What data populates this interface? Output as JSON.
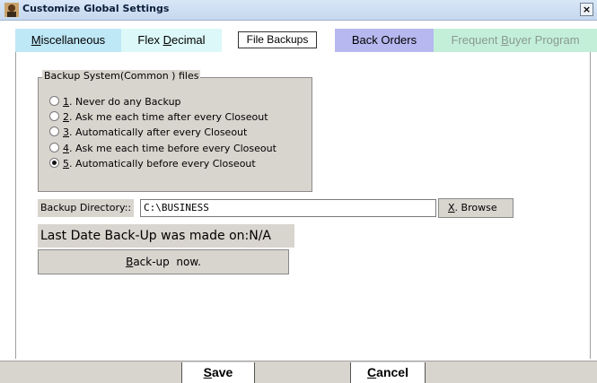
{
  "window": {
    "title": "Customize Global Settings",
    "close_label": "×",
    "icon": "app-icon"
  },
  "tabs": [
    {
      "key": "M",
      "rest": "iscellaneous",
      "prefix": "",
      "color": "#bfe8f7"
    },
    {
      "prefix": "Flex ",
      "key": "D",
      "rest": "ecimal",
      "color": "#dcf8f8"
    },
    {
      "label": "File Backups",
      "selected": true,
      "color": "#ffffff"
    },
    {
      "label": "Back Orders",
      "color": "#b6b8ef"
    },
    {
      "prefix": "Frequent ",
      "key": "B",
      "rest": "uyer Program",
      "color": "#c3efd9",
      "disabled": true
    }
  ],
  "backup_group": {
    "legend": "Backup System(Common ) files",
    "options": [
      {
        "num": "1",
        "text": ". Never do any Backup",
        "checked": false
      },
      {
        "num": "2",
        "text": ". Ask me each time after every Closeout",
        "checked": false
      },
      {
        "num": "3",
        "text": ". Automatically after every Closeout",
        "checked": false
      },
      {
        "num": "4",
        "text": ". Ask me each time before every Closeout",
        "checked": false
      },
      {
        "num": "5",
        "text": ". Automatically before every Closeout",
        "checked": true
      }
    ]
  },
  "directory": {
    "label": "Backup Directory::",
    "value": "C:\\BUSINESS",
    "browse_key": "X",
    "browse_rest": ". Browse"
  },
  "last_backup": {
    "text": "Last Date Back-Up was made on:N/A"
  },
  "backup_now": {
    "key": "B",
    "rest": "ack-up  now."
  },
  "footer": {
    "save_key": "S",
    "save_rest": "ave",
    "cancel_key": "C",
    "cancel_rest": "ancel"
  }
}
